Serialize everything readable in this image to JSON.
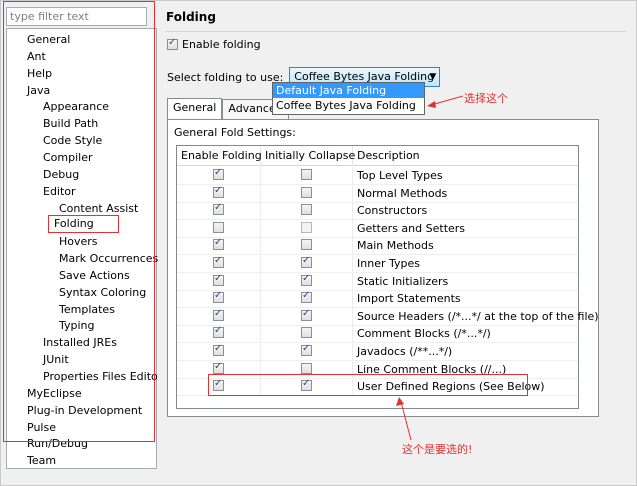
{
  "filter_placeholder": "type filter text",
  "tree": [
    {
      "label": "General",
      "level": 0
    },
    {
      "label": "Ant",
      "level": 0
    },
    {
      "label": "Help",
      "level": 0
    },
    {
      "label": "Java",
      "level": 0
    },
    {
      "label": "Appearance",
      "level": 1
    },
    {
      "label": "Build Path",
      "level": 1
    },
    {
      "label": "Code Style",
      "level": 1
    },
    {
      "label": "Compiler",
      "level": 1
    },
    {
      "label": "Debug",
      "level": 1
    },
    {
      "label": "Editor",
      "level": 1
    },
    {
      "label": "Content Assist",
      "level": 2
    },
    {
      "label": "Folding",
      "level": 2,
      "selected": true
    },
    {
      "label": "Hovers",
      "level": 2
    },
    {
      "label": "Mark Occurrences",
      "level": 2
    },
    {
      "label": "Save Actions",
      "level": 2
    },
    {
      "label": "Syntax Coloring",
      "level": 2
    },
    {
      "label": "Templates",
      "level": 2
    },
    {
      "label": "Typing",
      "level": 2
    },
    {
      "label": "Installed JREs",
      "level": 1
    },
    {
      "label": "JUnit",
      "level": 1
    },
    {
      "label": "Properties Files Edito",
      "level": 1
    },
    {
      "label": "MyEclipse",
      "level": 0
    },
    {
      "label": "Plug-in Development",
      "level": 0
    },
    {
      "label": "Pulse",
      "level": 0
    },
    {
      "label": "Run/Debug",
      "level": 0
    },
    {
      "label": "Team",
      "level": 0
    }
  ],
  "page_title": "Folding",
  "enable_folding": {
    "label": "Enable folding",
    "checked": true
  },
  "select_label": "Select folding to use:",
  "select_value": "Coffee Bytes Java Folding",
  "dropdown_options": [
    "Default Java Folding",
    "Coffee Bytes Java Folding"
  ],
  "annotation_select": "选择这个",
  "tabs": [
    "General",
    "Advanced"
  ],
  "general_settings_label": "General Fold Settings:",
  "table_headers": [
    "Enable Folding",
    "Initially Collapse",
    "Description"
  ],
  "rows": [
    {
      "enable": true,
      "collapse": false,
      "collapse_disabled": false,
      "desc": "Top Level Types"
    },
    {
      "enable": true,
      "collapse": false,
      "collapse_disabled": false,
      "desc": "Normal Methods"
    },
    {
      "enable": true,
      "collapse": false,
      "collapse_disabled": false,
      "desc": "Constructors"
    },
    {
      "enable": false,
      "collapse": false,
      "collapse_disabled": true,
      "desc": "Getters and Setters"
    },
    {
      "enable": true,
      "collapse": false,
      "collapse_disabled": false,
      "desc": "Main Methods"
    },
    {
      "enable": true,
      "collapse": true,
      "collapse_disabled": false,
      "desc": "Inner Types"
    },
    {
      "enable": true,
      "collapse": true,
      "collapse_disabled": false,
      "desc": "Static Initializers"
    },
    {
      "enable": true,
      "collapse": true,
      "collapse_disabled": false,
      "desc": "Import Statements"
    },
    {
      "enable": true,
      "collapse": true,
      "collapse_disabled": false,
      "desc": "Source Headers (/*...*/ at the top of the file)"
    },
    {
      "enable": true,
      "collapse": false,
      "collapse_disabled": false,
      "desc": "Comment Blocks (/*...*/)"
    },
    {
      "enable": true,
      "collapse": true,
      "collapse_disabled": false,
      "desc": "Javadocs (/**...*/)"
    },
    {
      "enable": true,
      "collapse": false,
      "collapse_disabled": false,
      "desc": "Line Comment Blocks (//...)"
    },
    {
      "enable": true,
      "collapse": true,
      "collapse_disabled": false,
      "desc": "User Defined Regions (See Below)"
    }
  ],
  "annotation_row": "这个是要选的!",
  "colors": {
    "annotation": "#e53030",
    "selection": "#3399ff"
  }
}
